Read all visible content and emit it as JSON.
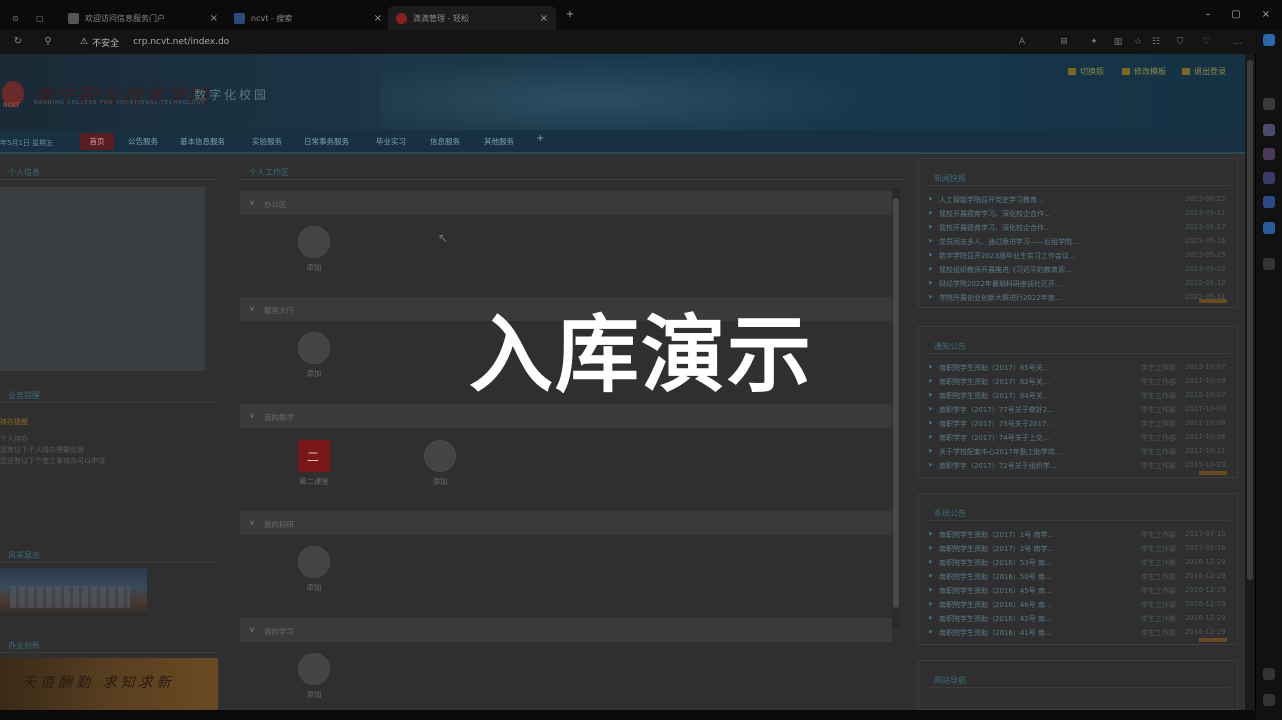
{
  "browser": {
    "tabs": [
      {
        "title": "欢迎访问信息服务门户",
        "icon_color": "#555555"
      },
      {
        "title": "ncvt - 搜索",
        "icon_color": "#2a4a7a"
      },
      {
        "title": "滴滴管理 - 轻松",
        "icon_color": "#8a2020"
      }
    ],
    "url_warning": "不安全",
    "url": "crp.ncvt.net/index.do"
  },
  "header": {
    "logo_text": "南宁职业技术学院",
    "logo_sub": "NCVT",
    "logo_en": "NANNING COLLEGE FOR VOCATIONAL TECHNOLOGY",
    "digital_campus": "数字化校园",
    "links": [
      "切换版",
      "修改模板",
      "退出登录"
    ]
  },
  "menu": {
    "date": "年5月1日 星期五",
    "items": [
      "首页",
      "公告服务",
      "基本信息服务",
      "实验服务",
      "日常事务服务",
      "毕业实习",
      "信息服务",
      "其他服务",
      "+"
    ]
  },
  "left": {
    "personal_title": "个人信息",
    "business_title": "业务提醒",
    "business_lines": [
      "待办提醒",
      "个人待办",
      "您有以下个人待办需要处理",
      "您还有以下个查工事待办可以申请"
    ],
    "campus_title": "风采展示",
    "culture_title": "办业创新",
    "culture_text": "天道酬勤 求知求新"
  },
  "workspace": {
    "title": "个人工作区",
    "sections": [
      {
        "label": "办公区",
        "apps": [
          {
            "label": "添加",
            "icon": "add-circle"
          }
        ]
      },
      {
        "label": "服务大厅",
        "apps": [
          {
            "label": "添加",
            "icon": "add-circle"
          }
        ]
      },
      {
        "label": "我的教学",
        "apps": [
          {
            "label": "第二课堂",
            "icon": "second-class"
          },
          {
            "label": "添加",
            "icon": "add-circle"
          }
        ]
      },
      {
        "label": "我的科研",
        "apps": [
          {
            "label": "添加",
            "icon": "add-circle"
          }
        ]
      },
      {
        "label": "我的学习",
        "apps": [
          {
            "label": "添加",
            "icon": "add-circle"
          }
        ]
      }
    ]
  },
  "right": {
    "news_title": "新闻快报",
    "news": [
      {
        "text": "人工智能学院召开党史学习教育...",
        "date": "2023-06-22"
      },
      {
        "text": "我校开展德育学习、深化校企合作...",
        "date": "2023-05-11"
      },
      {
        "text": "我校开展德育学习、深化校企合作...",
        "date": "2023-05-17"
      },
      {
        "text": "党员同志多人、通过跟进学习——后组学院...",
        "date": "2023-05-16"
      },
      {
        "text": "数字学院召开2023届毕业生实习工作会议...",
        "date": "2023-05-15"
      },
      {
        "text": "我校组织教师开展推进《习近平的教育观...",
        "date": "2023-05-12"
      },
      {
        "text": "财经学院2022年暑期科研座谈社区开...",
        "date": "2022-05-10"
      },
      {
        "text": "学院开展创业创新大赛进行2022年度...",
        "date": "2022-05-11"
      }
    ],
    "notice_title": "通知公告",
    "notices": [
      {
        "text": "南职院学生资助（2017）65号关...",
        "source": "学生工作部",
        "date": "2013-10-07"
      },
      {
        "text": "南职院学生资助（2017）62号关...",
        "source": "学生工作部",
        "date": "2017-10-09"
      },
      {
        "text": "南职院学生资助（2017）64号关...",
        "source": "学生工作部",
        "date": "2015-10-07"
      },
      {
        "text": "南职学字（2017）77号关于做好2...",
        "source": "学生工作部",
        "date": "2017-10-03"
      },
      {
        "text": "南职学字（2017）75号关于2017...",
        "source": "学生工作部",
        "date": "2017-10-08"
      },
      {
        "text": "南职学字（2017）74号关于上交...",
        "source": "学生工作部",
        "date": "2017-10-06"
      },
      {
        "text": "关于学校配套中心2017年勤工助学岗...",
        "source": "学生工作部",
        "date": "2017-10-21"
      },
      {
        "text": "南职学字（2017）72号关于组织学...",
        "source": "学生工作部",
        "date": "2015-10-23"
      }
    ],
    "dept_title": "系统公告",
    "dept_notices": [
      {
        "text": "南职院学生资助（2017）1号 南学...",
        "source": "学生工作部",
        "date": "2017-07-10"
      },
      {
        "text": "南职院学生资助（2017）2号 南学...",
        "source": "学生工作部",
        "date": "2017-01-16"
      },
      {
        "text": "南职院学生资助（2016）53号 南...",
        "source": "学生工作部",
        "date": "2016-12-29"
      },
      {
        "text": "南职院学生资助（2016）50号 南...",
        "source": "学生工作部",
        "date": "2016-12-29"
      },
      {
        "text": "南职院学生资助（2016）45号 南...",
        "source": "学生工作部",
        "date": "2016-12-29"
      },
      {
        "text": "南职院学生资助（2016）46号 南...",
        "source": "学生工作部",
        "date": "2016-12-29"
      },
      {
        "text": "南职院学生资助（2016）42号 南...",
        "source": "学生工作部",
        "date": "2016-12-29"
      },
      {
        "text": "南职院学生资助（2016）41号 南...",
        "source": "学生工作部",
        "date": "2016-12-29"
      }
    ],
    "nav_title": "网站导航"
  },
  "overlay": {
    "text": "入库演示"
  }
}
